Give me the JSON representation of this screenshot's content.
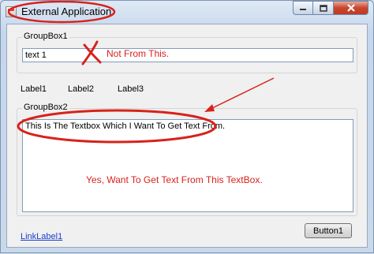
{
  "window": {
    "title": "External Application"
  },
  "groupbox1": {
    "title": "GroupBox1",
    "textbox_value": "text 1"
  },
  "labels": [
    "Label1",
    "Label2",
    "Label3"
  ],
  "groupbox2": {
    "title": "GroupBox2",
    "textbox_value": "This Is The Textbox Which I Want To Get Text From."
  },
  "footer": {
    "link_label": "LinkLabel1",
    "button_label": "Button1"
  },
  "annotations": {
    "not_from_this": "Not From This.",
    "yes_text": "Yes, Want To Get Text From This TextBox.",
    "color": "#d8221b"
  },
  "icons": [
    "app-icon",
    "minimize-icon",
    "maximize-icon",
    "close-icon"
  ]
}
